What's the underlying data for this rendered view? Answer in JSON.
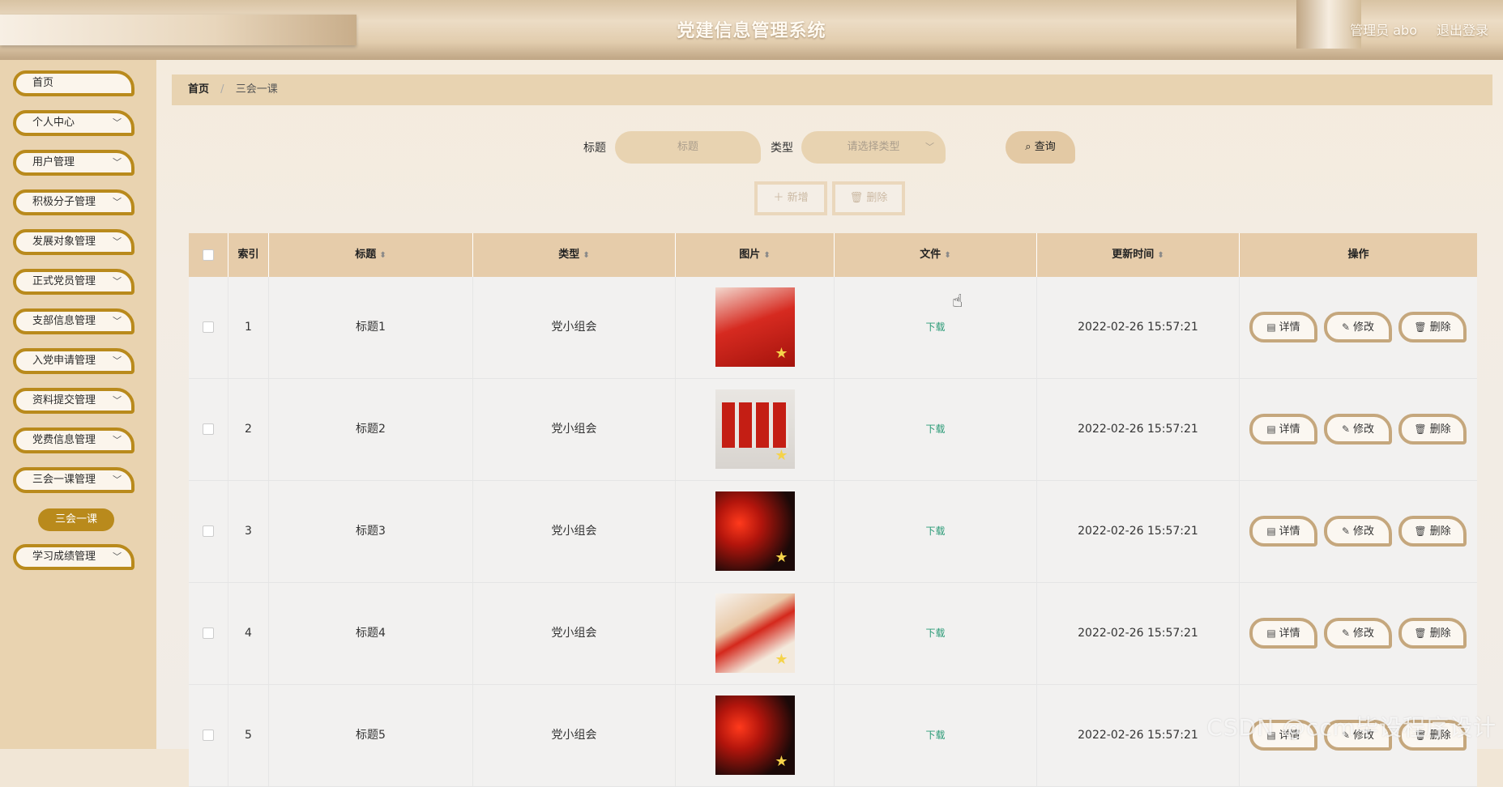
{
  "header": {
    "title": "党建信息管理系统",
    "user": "管理员 abo",
    "logout": "退出登录"
  },
  "sidebar": {
    "items": [
      {
        "label": "首页",
        "chevron": false
      },
      {
        "label": "个人中心",
        "chevron": true
      },
      {
        "label": "用户管理",
        "chevron": true
      },
      {
        "label": "积极分子管理",
        "chevron": true
      },
      {
        "label": "发展对象管理",
        "chevron": true
      },
      {
        "label": "正式党员管理",
        "chevron": true
      },
      {
        "label": "支部信息管理",
        "chevron": true
      },
      {
        "label": "入党申请管理",
        "chevron": true
      },
      {
        "label": "资料提交管理",
        "chevron": true
      },
      {
        "label": "党费信息管理",
        "chevron": true
      },
      {
        "label": "三会一课管理",
        "chevron": true
      },
      {
        "label": "学习成绩管理",
        "chevron": true
      }
    ],
    "sub_item": "三会一课"
  },
  "breadcrumb": {
    "home": "首页",
    "separator": "/",
    "current": "三会一课"
  },
  "search": {
    "title_label": "标题",
    "title_placeholder": "标题",
    "type_label": "类型",
    "type_placeholder": "请选择类型",
    "query_label": "查询"
  },
  "actions": {
    "add_label": "新增",
    "delete_label": "删除"
  },
  "table": {
    "headers": {
      "index": "索引",
      "title": "标题",
      "type": "类型",
      "image": "图片",
      "file": "文件",
      "updated": "更新时间",
      "ops": "操作"
    },
    "rows": [
      {
        "index": "1",
        "title": "标题1",
        "type": "党小组会",
        "file": "下载",
        "updated": "2022-02-26 15:57:21",
        "image_style": "v1"
      },
      {
        "index": "2",
        "title": "标题2",
        "type": "党小组会",
        "file": "下载",
        "updated": "2022-02-26 15:57:21",
        "image_style": "v2"
      },
      {
        "index": "3",
        "title": "标题3",
        "type": "党小组会",
        "file": "下载",
        "updated": "2022-02-26 15:57:21",
        "image_style": "v3"
      },
      {
        "index": "4",
        "title": "标题4",
        "type": "党小组会",
        "file": "下载",
        "updated": "2022-02-26 15:57:21",
        "image_style": "v4"
      },
      {
        "index": "5",
        "title": "标题5",
        "type": "党小组会",
        "file": "下载",
        "updated": "2022-02-26 15:57:21",
        "image_style": "v3"
      }
    ],
    "row_actions": {
      "detail": "详情",
      "edit": "修改",
      "delete": "删除"
    }
  },
  "watermark": "CSDN @ccm毕设程序设计",
  "colors": {
    "accent": "#b98a1c",
    "header_bg": "#e6ccaa",
    "download": "#2a9a76"
  }
}
